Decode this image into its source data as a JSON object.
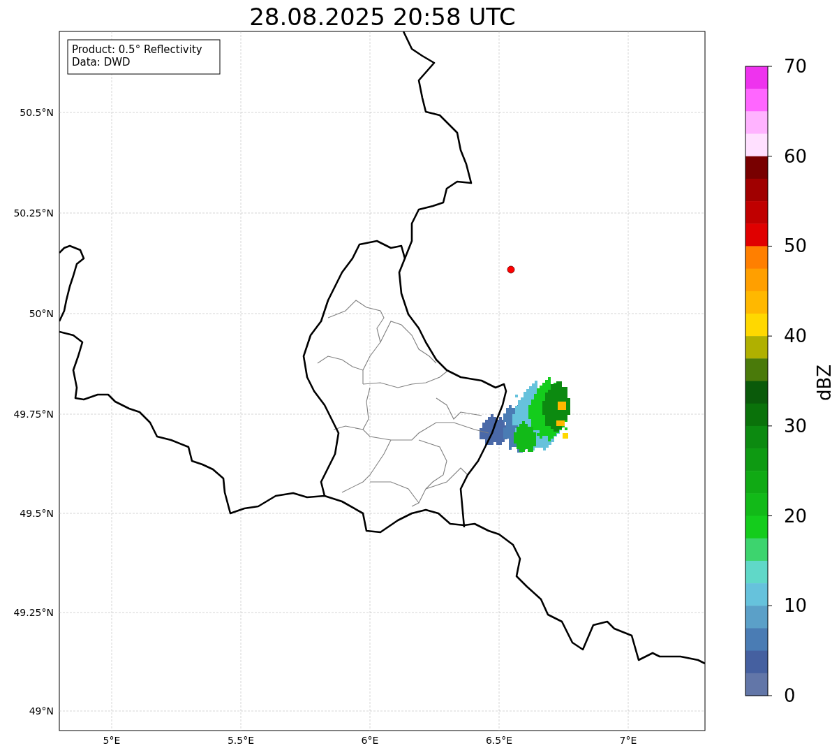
{
  "title": "28.08.2025 20:58 UTC",
  "info_box": [
    "Product: 0.5° Reflectivity",
    "Data: DWD"
  ],
  "map": {
    "lat_ticks": [
      "50.5°N",
      "50.25°N",
      "50°N",
      "49.75°N",
      "49.5°N",
      "49.25°N",
      "49°N"
    ],
    "lon_ticks": [
      "5°E",
      "5.5°E",
      "6°E",
      "6.5°E",
      "7°E"
    ]
  },
  "colorbar": {
    "label": "dBZ",
    "ticks": [
      "70",
      "60",
      "50",
      "40",
      "30",
      "20",
      "10",
      "0"
    ],
    "bands": [
      {
        "color": "#ee33ee"
      },
      {
        "color": "#ff66ff"
      },
      {
        "color": "#ffb3ff"
      },
      {
        "color": "#ffe0ff"
      },
      {
        "color": "#780000"
      },
      {
        "color": "#a00000"
      },
      {
        "color": "#c00000"
      },
      {
        "color": "#e00000"
      },
      {
        "color": "#ff7f00"
      },
      {
        "color": "#ff9f00"
      },
      {
        "color": "#ffb800"
      },
      {
        "color": "#ffd800"
      },
      {
        "color": "#b0b000"
      },
      {
        "color": "#4a7a0a"
      },
      {
        "color": "#0a5a0a"
      },
      {
        "color": "#0a720a"
      },
      {
        "color": "#0c8a10"
      },
      {
        "color": "#0e9a12"
      },
      {
        "color": "#10aa14"
      },
      {
        "color": "#12ba18"
      },
      {
        "color": "#14cc1c"
      },
      {
        "color": "#3dd46e"
      },
      {
        "color": "#60d8c8"
      },
      {
        "color": "#66c2dc"
      },
      {
        "color": "#5ba0c8"
      },
      {
        "color": "#4a7cb4"
      },
      {
        "color": "#4560a0"
      },
      {
        "color": "#6276a8"
      }
    ]
  }
}
